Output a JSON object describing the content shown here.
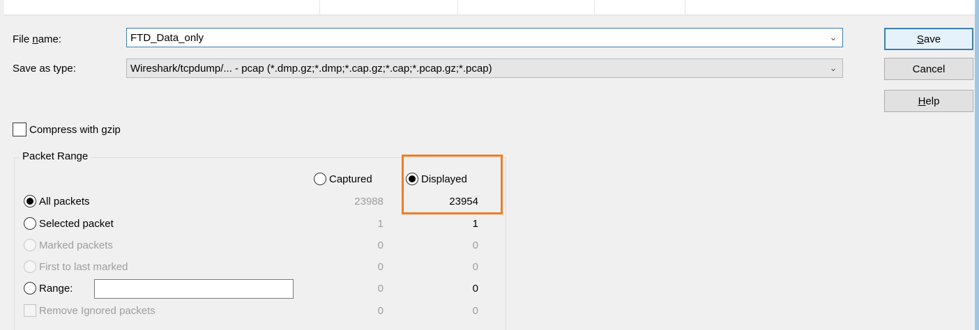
{
  "dialog": {
    "file_name": {
      "label_before": "File ",
      "label_accel": "n",
      "label_after": "ame:",
      "value": "FTD_Data_only"
    },
    "save_as_type": {
      "label": "Save as type:",
      "value": "Wireshark/tcpdump/... - pcap (*.dmp.gz;*.dmp;*.cap.gz;*.cap;*.pcap.gz;*.pcap)"
    },
    "buttons": {
      "save": {
        "accel": "S",
        "rest": "ave"
      },
      "cancel": "Cancel",
      "help": {
        "accel": "H",
        "rest": "elp"
      }
    },
    "compress": {
      "label": "Compress with gzip",
      "checked": false
    }
  },
  "packet_range": {
    "title": "Packet Range",
    "columns": {
      "captured": {
        "label": "Captured",
        "selected": false
      },
      "displayed": {
        "label": "Displayed",
        "selected": true
      }
    },
    "rows": [
      {
        "label": "All packets",
        "captured": "23988",
        "displayed": "23954",
        "selected": true,
        "enabled": true
      },
      {
        "label": "Selected packet",
        "captured": "1",
        "displayed": "1",
        "selected": false,
        "enabled": true
      },
      {
        "label": "Marked packets",
        "captured": "0",
        "displayed": "0",
        "selected": false,
        "enabled": false
      },
      {
        "label": "First to last marked",
        "captured": "0",
        "displayed": "0",
        "selected": false,
        "enabled": false
      },
      {
        "label": "Range:",
        "captured": "0",
        "displayed": "0",
        "selected": false,
        "enabled": true,
        "input_value": ""
      }
    ],
    "remove_ignored": {
      "label": "Remove Ignored packets",
      "captured": "0",
      "displayed": "0",
      "checked": false,
      "enabled": false
    }
  },
  "annotation": {
    "highlight_color": "#f07c22"
  }
}
